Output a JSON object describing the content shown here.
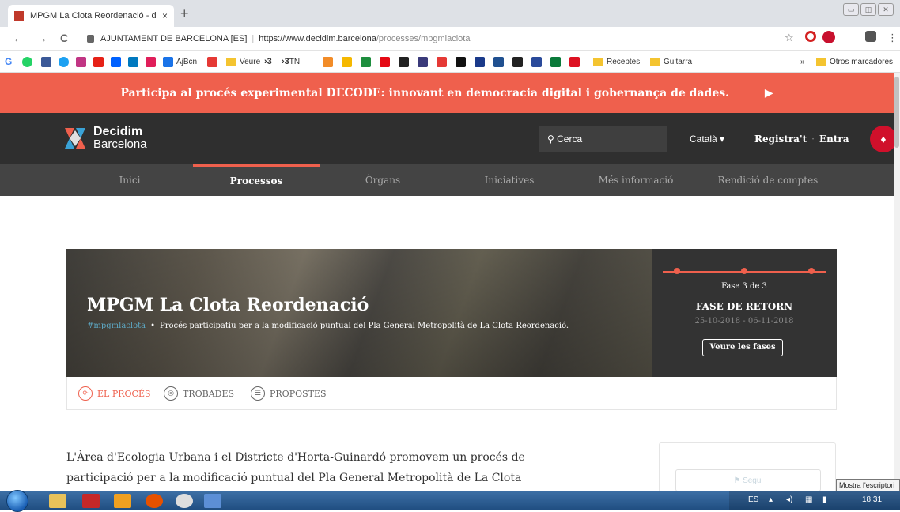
{
  "browser": {
    "tab_title": "MPGM La Clota Reordenació - d",
    "tab_close": "×",
    "new_tab": "+",
    "url_org": "AJUNTAMENT DE BARCELONA [ES]",
    "url_sep": "|",
    "url_host": "https://www.decidim.barcelona",
    "url_path": "/processes/mpgmlaclota",
    "back": "←",
    "forward": "→",
    "reload": "C",
    "star": "☆",
    "menu": "⋮"
  },
  "bookmarks": {
    "aj_bcn": "AjBcn",
    "veure": "Veure",
    "k3": "3",
    "tn": "TN",
    "receptes": "Receptes",
    "guitarra": "Guitarra",
    "more": "»",
    "others": "Otros marcadores"
  },
  "banner": {
    "text": "Participa al procés experimental DECODE: innovant en democracia digital i gobernança de dades.",
    "arrow": "▶"
  },
  "header": {
    "logo_line1": "Decidim",
    "logo_line2": "Barcelona",
    "search_placeholder": "Cerca",
    "language": "Català",
    "register": "Registra't",
    "dot": "·",
    "login": "Entra"
  },
  "nav": {
    "items": [
      "Inici",
      "Processos",
      "Òrgans",
      "Iniciatives",
      "Més informació",
      "Rendició de comptes"
    ],
    "active": "Processos"
  },
  "hero": {
    "title": "MPGM La Clota Reordenació",
    "hashtag": "#mpgmlaclota",
    "bullet": "•",
    "subtitle": "Procés participatiu per a la modificació puntual del Pla General Metropolità de La Clota Reordenació.",
    "phase_label": "Fase 3 de 3",
    "phase_name": "FASE DE RETORN",
    "phase_dates": "25-10-2018 - 06-11-2018",
    "phase_button": "Veure les fases"
  },
  "subnav": {
    "proces": "EL PROCÉS",
    "trobades": "TROBADES",
    "propostes": "PROPOSTES"
  },
  "body": {
    "text": "L'Àrea d'Ecologia Urbana i el Districte d'Horta-Guinardó promovem un procés de participació per a la modificació puntual del Pla General Metropolità de La Clota Reordenació."
  },
  "sidebar": {
    "follow": "Segui"
  },
  "tooltip": "Mostra l'escriptori",
  "taskbar": {
    "lang": "ES",
    "time": "18:31"
  },
  "colors": {
    "accent": "#ef604d",
    "header_bg": "#2f2f2f",
    "nav_bg": "#444444"
  }
}
